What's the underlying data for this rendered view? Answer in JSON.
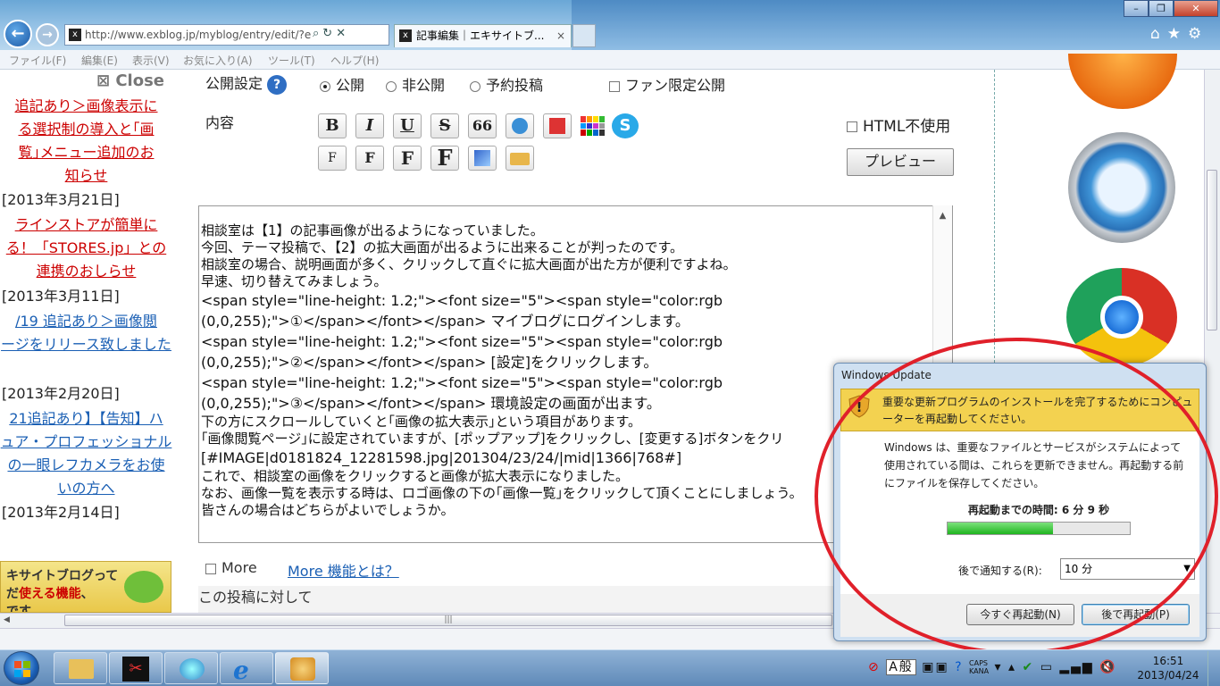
{
  "browser": {
    "url": "http://www.exblog.jp/myblog/entry/edit/?e",
    "url_host": "exblog.jp",
    "tab_title": "記事編集｜エキサイトブ...",
    "tab_close": "×",
    "favicon": "x"
  },
  "menu": [
    "ファイル(F)",
    "編集(E)",
    "表示(V)",
    "お気に入り(A)",
    "ツール(T)",
    "ヘルプ(H)"
  ],
  "sidebar": {
    "close_label": "⊠ Close",
    "items": [
      {
        "lines": [
          "追記あり＞画像表示に",
          "る選択制の導入と｢画",
          "覧｣メニュー追加のお",
          "知らせ"
        ],
        "style": "red",
        "date": "[2013年3月21日]"
      },
      {
        "lines": [
          "ラインストアが簡単に",
          "る！「STORES.jp」との",
          "連携のおしらせ"
        ],
        "style": "red",
        "date": "[2013年3月11日]"
      },
      {
        "lines": [
          "/19 追記あり＞画像閲",
          "ージをリリース致しました"
        ],
        "style": "blue",
        "date": "[2013年2月20日]"
      },
      {
        "lines": [
          "21追記あり】【告知】ハ",
          "ュア・プロフェッショナル",
          "の一眼レフカメラをお使",
          "いの方へ"
        ],
        "style": "blue",
        "date": "[2013年2月14日]"
      }
    ],
    "banner_line1": "キサイトブログって",
    "banner_line2_pre": "だ",
    "banner_line2_hl": "使える機能",
    "banner_line2_post": "、",
    "banner_line3": "です"
  },
  "form": {
    "publish_label": "公開設定",
    "help_icon": "?",
    "options": {
      "public": "公開",
      "private": "非公開",
      "scheduled": "予約投稿",
      "fan_only": "ファン限定公開"
    },
    "content_label": "内容",
    "toolbar_row1": [
      "B",
      "I",
      "U",
      "S",
      "66"
    ],
    "toolbar_row2": [
      "F",
      "F",
      "F",
      "F"
    ],
    "html_nouse": "HTML不使用",
    "preview_button": "プレビュー",
    "more_label": "More",
    "more_link": "More 機能とは？",
    "this_post": "この投稿に対して"
  },
  "editor": {
    "lines": [
      {
        "t": "相談室は【1】の記事画像が出るようになっていました。",
        "c": false
      },
      {
        "t": "今回、テーマ投稿で、【2】の拡大画面が出るように出来ることが判ったのです。",
        "c": false
      },
      {
        "t": "相談室の場合、説明画面が多く、クリックして直ぐに拡大画面が出た方が便利ですよね。",
        "c": false
      },
      {
        "t": "早速、切り替えてみましょう。",
        "c": false
      },
      {
        "t": "<span style=\"line-height: 1.2;\"><font size=\"5\"><span style=\"color:rgb",
        "c": true
      },
      {
        "t": "(0,0,255);\">①</span></font></span> マイブログにログインします。",
        "c": true
      },
      {
        "t": "<span style=\"line-height: 1.2;\"><font size=\"5\"><span style=\"color:rgb",
        "c": true
      },
      {
        "t": "(0,0,255);\">②</span></font></span> [設定]をクリックします。",
        "c": true
      },
      {
        "t": "<span style=\"line-height: 1.2;\"><font size=\"5\"><span style=\"color:rgb",
        "c": true
      },
      {
        "t": "(0,0,255);\">③</span></font></span> 環境設定の画面が出ます。",
        "c": true
      },
      {
        "t": "下の方にスクロールしていくと｢画像の拡大表示｣という項目があります。",
        "c": false
      },
      {
        "t": "｢画像閲覧ページ｣に設定されていますが、[ポップアップ]をクリックし、[変更する]ボタンをクリ",
        "c": false
      },
      {
        "t": "[#IMAGE|d0181824_12281598.jpg|201304/23/24/|mid|1366|768#]",
        "c": true
      },
      {
        "t": "これで、相談室の画像をクリックすると画像が拡大表示になりました。",
        "c": false
      },
      {
        "t": "なお、画像一覧を表示する時は、ロゴ画像の下の｢画像一覧｣をクリックして頂くことにしましょう。",
        "c": false
      },
      {
        "t": " ",
        "c": false
      },
      {
        "t": "皆さんの場合はどちらがよいでしょうか。",
        "c": false
      }
    ]
  },
  "dialog": {
    "title": "Windows Update",
    "warning": "重要な更新プログラムのインストールを完了するためにコンピューターを再起動してください。",
    "description": "Windows は、重要なファイルとサービスがシステムによって使用されている間は、これらを更新できません。再起動する前にファイルを保存してください。",
    "time_label": "再起動までの時間: 6 分 9 秒",
    "progress": 0.58,
    "remind_label": "後で通知する(R):",
    "remind_value": "10 分",
    "restart_now": "今すぐ再起動(N)",
    "restart_later": "後で再起動(P)"
  },
  "taskbar": {
    "tray_ime": "A般",
    "tray_caps": "CAPS",
    "tray_kana": "KANA",
    "time": "16:51",
    "date": "2013/04/24"
  },
  "colors": {
    "highlight_ring": "#e0202a",
    "link_red": "#cc0000",
    "link_blue": "#1a5fb4",
    "progress": "#1fb41f"
  }
}
